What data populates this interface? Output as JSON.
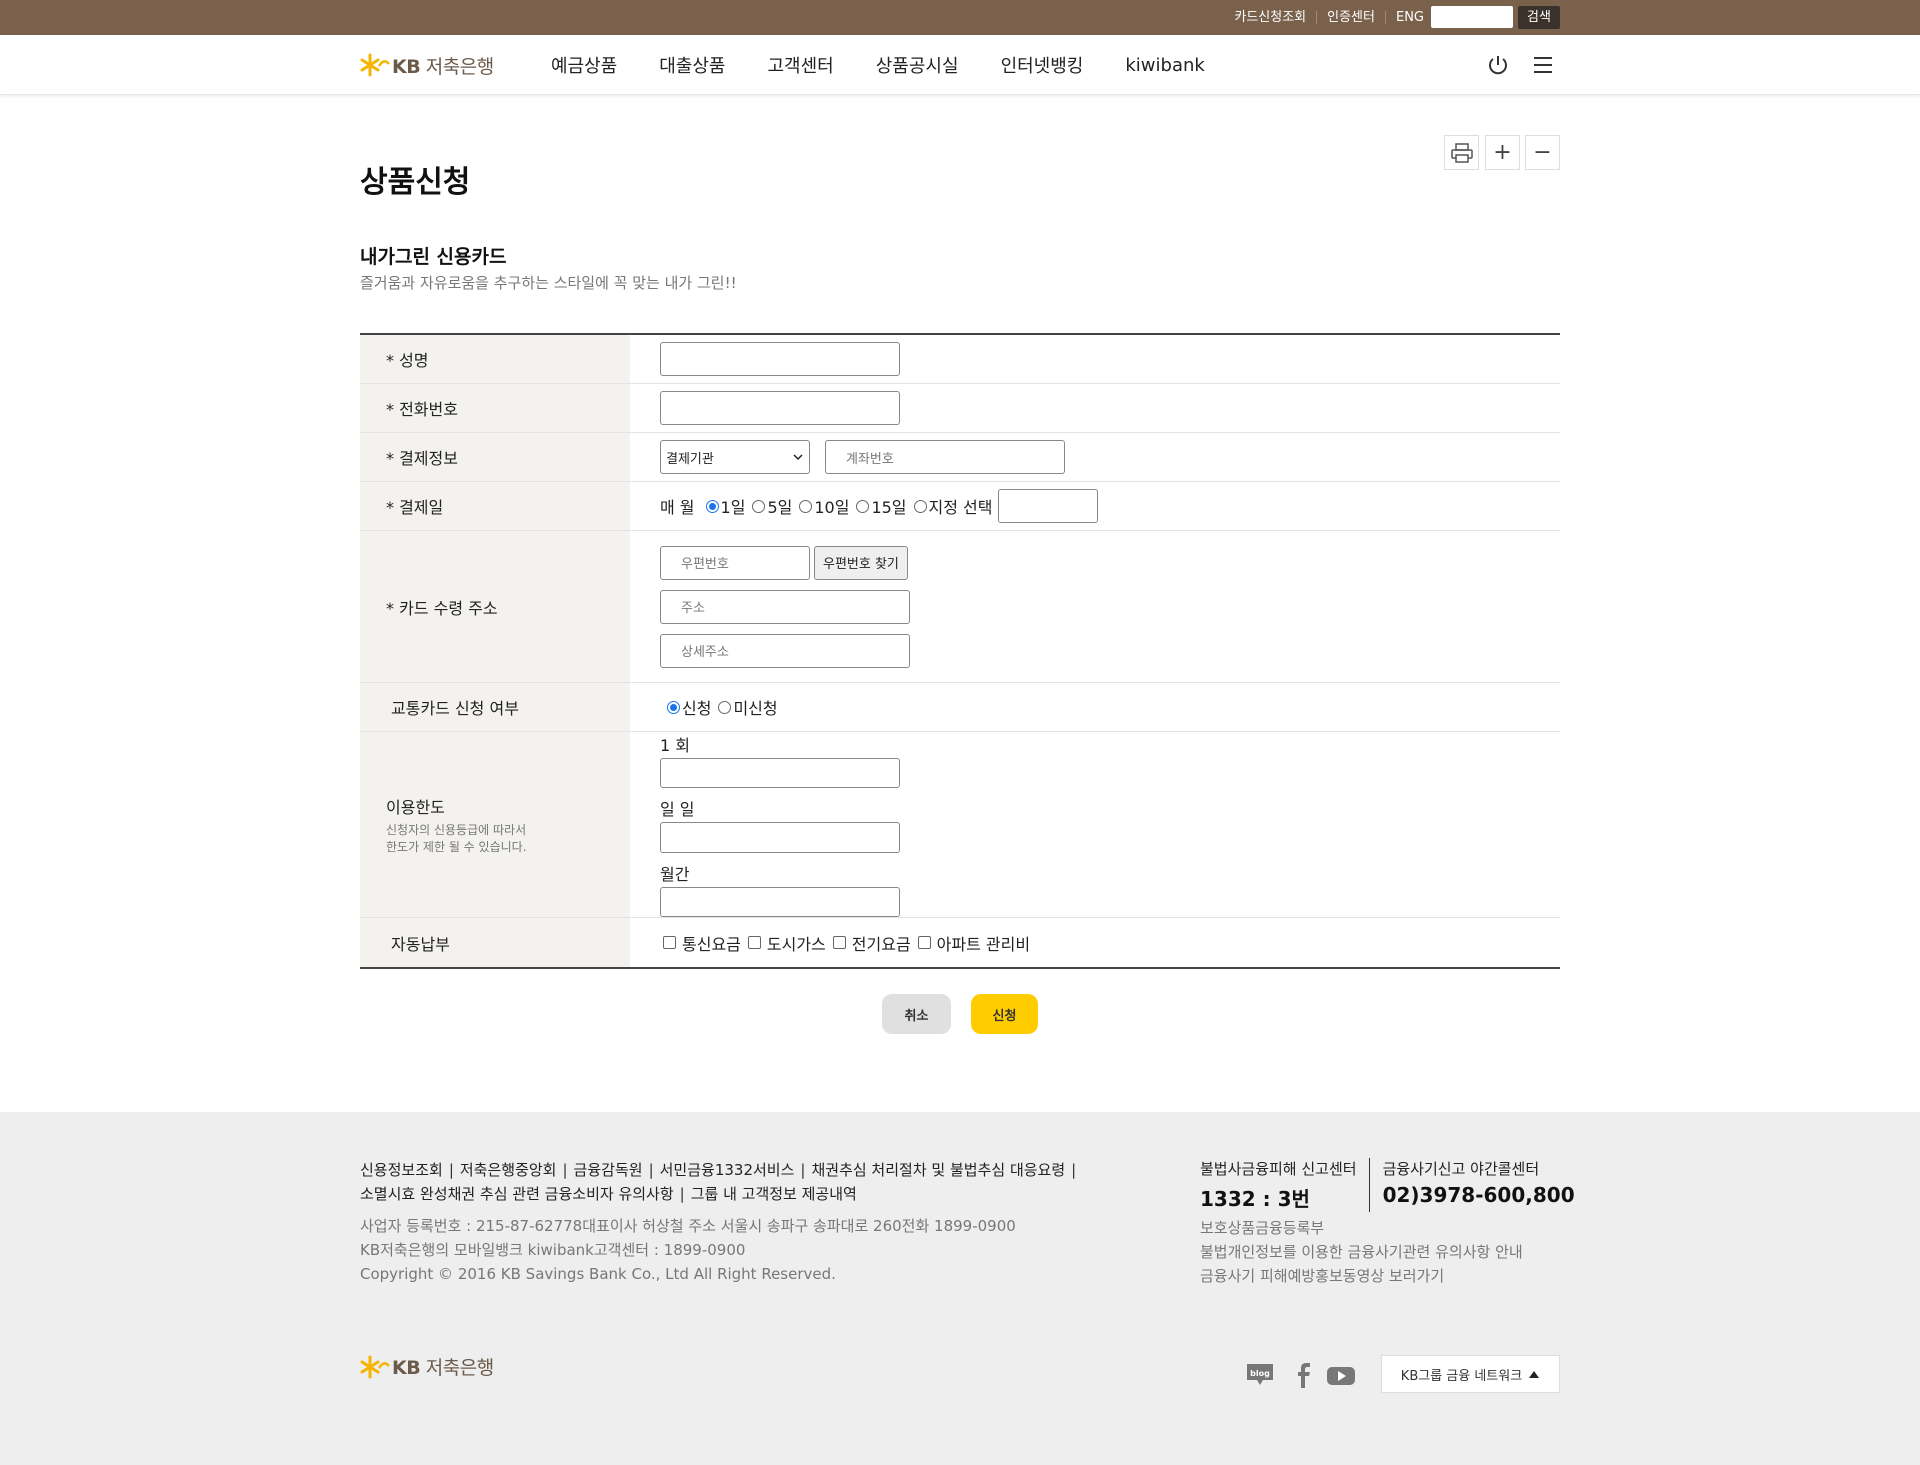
{
  "util": {
    "links": [
      "카드신청조회",
      "인증센터",
      "ENG"
    ],
    "search_button": "검색"
  },
  "header": {
    "logo_text_kb": "KB",
    "logo_text_name": "저축은행",
    "menu": [
      "예금상품",
      "대출상품",
      "고객센터",
      "상품공시실",
      "인터넷뱅킹",
      "kiwibank"
    ]
  },
  "tools": {
    "zoom_in": "+",
    "zoom_out": "−"
  },
  "page": {
    "title": "상품신청",
    "product_name": "내가그린 신용카드",
    "product_desc": "즐거움과 자유로움을 추구하는 스타일에 꼭 맞는 내가 그린!!"
  },
  "form": {
    "name_label": "* 성명",
    "phone_label": "* 전화번호",
    "payment_label": "* 결제정보",
    "payment_bank_select": "결제기관",
    "payment_account_placeholder": "계좌번호",
    "payday_label": "* 결제일",
    "payday_prefix": "매 월",
    "payday_options": [
      "1일",
      "5일",
      "10일",
      "15일",
      "지정 선택"
    ],
    "payday_selected": "1일",
    "address_label": "* 카드 수령 주소",
    "zipcode_placeholder": "우편번호",
    "zipcode_button": "우편번호 찾기",
    "address_placeholder": "주소",
    "address_detail_placeholder": "상세주소",
    "transit_label": "교통카드 신청 여부",
    "transit_options": [
      "신청",
      "미신청"
    ],
    "transit_selected": "신청",
    "limit_label": "이용한도",
    "limit_note_1": "신청자의 신용등급에 따라서",
    "limit_note_2": "한도가 제한 될 수 있습니다.",
    "limit_once": "1 회",
    "limit_daily": "일 일",
    "limit_monthly": "월간",
    "autopay_label": "자동납부",
    "autopay_options": [
      "통신요금",
      "도시가스",
      "전기요금",
      "아파트 관리비"
    ]
  },
  "actions": {
    "cancel": "취소",
    "submit": "신청"
  },
  "footer": {
    "links_line1": [
      "신용정보조회",
      "저축은행중앙회",
      "금융감독원",
      "서민금융1332서비스",
      "채권추심 처리절차 및 불법추심 대응요령"
    ],
    "links_line2": [
      "소멸시효 완성채권 추심 관련 금융소비자 유의사항",
      "그룹 내 고객정보 제공내역"
    ],
    "info_1": "사업자 등록번호 : 215-87-62778대표이사 허상철 주소 서울시 송파구 송파대로 260전화 1899-0900",
    "info_2": "KB저축은행의 모바일뱅크 kiwibank고객센터 : 1899-0900",
    "info_3": "Copyright © 2016 KB Savings Bank Co., Ltd All Right Reserved.",
    "center1_label": "불법사금융피해 신고센터",
    "center1_num": "1332 : 3번",
    "center2_label": "금융사기신고 야간콜센터",
    "center2_num": "02)3978-600,800",
    "right_links": [
      "보호상품금융등록부",
      "불법개인정보를 이용한 금융사기관련 유의사항 안내",
      "금융사기 피해예방홍보동영상 보러가기"
    ],
    "blog_label": "blog",
    "network_label": "KB그룹 금융 네트워크"
  },
  "colors": {
    "util_bar": "#7a614c",
    "accent_yellow": "#ffcc00",
    "footer_bg": "#eeeeee"
  }
}
